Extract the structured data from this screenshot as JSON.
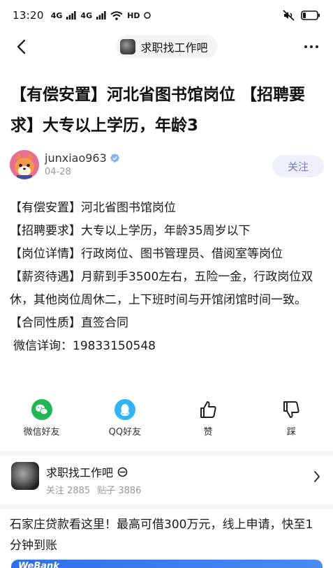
{
  "status_bar": {
    "time": "13:20",
    "signal_1": "4G",
    "signal_2": "4G",
    "network": "HD",
    "battery_icon": "battery-icon"
  },
  "nav": {
    "forum_name": "求职找工作吧"
  },
  "post": {
    "title": "【有偿安置】河北省图书馆岗位 【招聘要求】大专以上学历，年龄3",
    "author": "junxiao963",
    "date": "04-28",
    "follow_label": "关注",
    "lines": [
      "【有偿安置】河北省图书馆岗位",
      "【招聘要求】大专以上学历，年龄35周岁以下",
      "【岗位详情】行政岗位、图书管理员、借阅室等岗位",
      "【薪资待遇】月薪到手3500左右，五险一金，行政岗位双休，其他岗位周休二，上下班时间与开馆闭馆时间一致。",
      "【合同性质】直签合同",
      "微信详询：19833150548"
    ]
  },
  "actions": [
    {
      "label": "微信好友",
      "icon": "wechat-icon"
    },
    {
      "label": "QQ好友",
      "icon": "qq-icon"
    },
    {
      "label": "赞",
      "icon": "thumbs-up-icon"
    },
    {
      "label": "踩",
      "icon": "thumbs-down-icon"
    }
  ],
  "forum_card": {
    "name": "求职找工作吧",
    "follow_count": "关注 2885",
    "post_count": "贴子 3886"
  },
  "ad": {
    "text": "石家庄贷款看这里！最高可借300万元，线上申请，快至1分钟到账",
    "banner_text": "WeBank"
  },
  "colors": {
    "accent": "#6f78d8",
    "follow_bg": "#eef0fb",
    "wechat_green": "#1fb954",
    "qq_blue": "#2fb4f5"
  }
}
